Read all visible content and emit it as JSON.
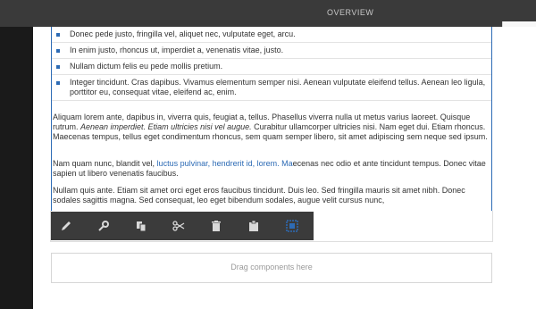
{
  "header": {
    "title": "OVERVIEW"
  },
  "editor": {
    "bullets": [
      "Donec pede justo, fringilla vel, aliquet nec, vulputate eget, arcu.",
      "In enim justo, rhoncus ut, imperdiet a, venenatis vitae, justo.",
      "Nullam dictum felis eu pede mollis pretium.",
      "Integer tincidunt. Cras dapibus. Vivamus elementum semper nisi. Aenean vulputate eleifend tellus. Aenean leo ligula, porttitor eu, consequat vitae, eleifend ac, enim."
    ],
    "para1": {
      "a": "Aliquam lorem ante, dapibus in, viverra quis, feugiat a, tellus. Phasellus viverra nulla ut metus varius laoreet. Quisque rutrum. ",
      "italic": "Aenean imperdiet. Etiam ultricies nisi vel augue.",
      "b": " Curabitur ullamcorper ultricies nisi. Nam eget dui. Etiam rhoncus. Maecenas tempus, tellus eget condimentum rhoncus, sem quam semper libero, sit amet adipiscing sem neque sed ipsum."
    },
    "para2": {
      "a": "Nam quam nunc, blandit vel, ",
      "link": "luctus pulvinar, hendrerit id, lorem. Ma",
      "b": "ecenas nec odio et ante tincidunt tempus. Donec vitae sapien ut libero venenatis faucibus."
    },
    "para3": "Nullam quis ante. Etiam sit amet orci eget eros faucibus tincidunt. Duis leo. Sed fringilla mauris sit amet nibh. Donec sodales sagittis magna. Sed consequat, leo eget bibendum sodales, augue velit cursus nunc,"
  },
  "toolbar": {
    "icons": [
      "pencil-icon",
      "wrench-icon",
      "copy-icon",
      "scissors-icon",
      "trash-icon",
      "clipboard-icon",
      "group-icon"
    ]
  },
  "dropzone": {
    "label": "Drag components here"
  },
  "colors": {
    "accent": "#2d6bb5",
    "toolbar": "#3b3b3b",
    "topbar": "#3a3a3a",
    "rail": "#1a1a1a"
  }
}
